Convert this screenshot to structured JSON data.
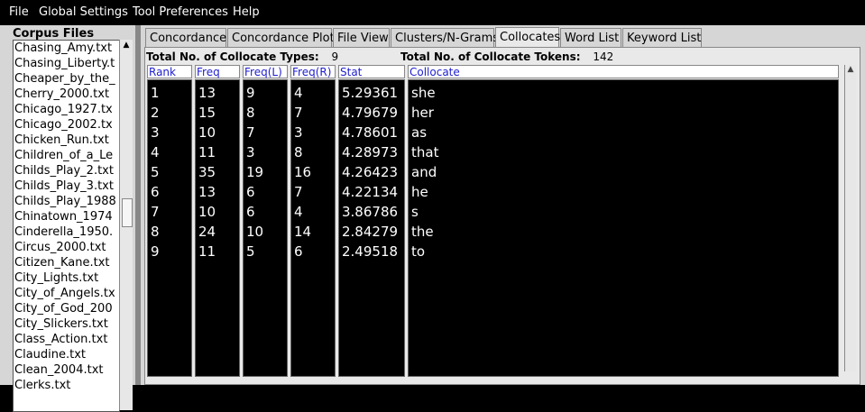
{
  "menu": {
    "items": [
      "File",
      "Global Settings",
      "Tool Preferences",
      "Help"
    ]
  },
  "corpus": {
    "title": "Corpus Files",
    "files": [
      "Chasing_Amy.txt",
      "Chasing_Liberty.t",
      "Cheaper_by_the_",
      "Cherry_2000.txt",
      "Chicago_1927.tx",
      "Chicago_2002.tx",
      "Chicken_Run.txt",
      "Children_of_a_Le",
      "Childs_Play_2.txt",
      "Childs_Play_3.txt",
      "Childs_Play_1988",
      "Chinatown_1974",
      "Cinderella_1950.",
      "Circus_2000.txt",
      "Citizen_Kane.txt",
      "City_Lights.txt",
      "City_of_Angels.tx",
      "City_of_God_200",
      "City_Slickers.txt",
      "Class_Action.txt",
      "Claudine.txt",
      "Clean_2004.txt",
      "Clerks.txt"
    ]
  },
  "tabs": [
    {
      "label": "Concordance",
      "active": false
    },
    {
      "label": "Concordance Plot",
      "active": false
    },
    {
      "label": "File View",
      "active": false
    },
    {
      "label": "Clusters/N-Grams",
      "active": false
    },
    {
      "label": "Collocates",
      "active": true
    },
    {
      "label": "Word List",
      "active": false
    },
    {
      "label": "Keyword List",
      "active": false
    }
  ],
  "totals": {
    "types_label": "Total No. of Collocate Types:",
    "types_value": "9",
    "tokens_label": "Total No. of Collocate Tokens:",
    "tokens_value": "142"
  },
  "table": {
    "headers": [
      "Rank",
      "Freq",
      "Freq(L)",
      "Freq(R)",
      "Stat",
      "Collocate"
    ],
    "rows": [
      [
        "1",
        "13",
        "9",
        "4",
        "5.29361",
        "she"
      ],
      [
        "2",
        "15",
        "8",
        "7",
        "4.79679",
        "her"
      ],
      [
        "3",
        "10",
        "7",
        "3",
        "4.78601",
        "as"
      ],
      [
        "4",
        "11",
        "3",
        "8",
        "4.28973",
        "that"
      ],
      [
        "5",
        "35",
        "19",
        "16",
        "4.26423",
        "and"
      ],
      [
        "6",
        "13",
        "6",
        "7",
        "4.22134",
        "he"
      ],
      [
        "7",
        "10",
        "6",
        "4",
        "3.86786",
        "s"
      ],
      [
        "8",
        "24",
        "10",
        "14",
        "2.84279",
        "the"
      ],
      [
        "9",
        "11",
        "5",
        "6",
        "2.49518",
        "to"
      ]
    ]
  }
}
